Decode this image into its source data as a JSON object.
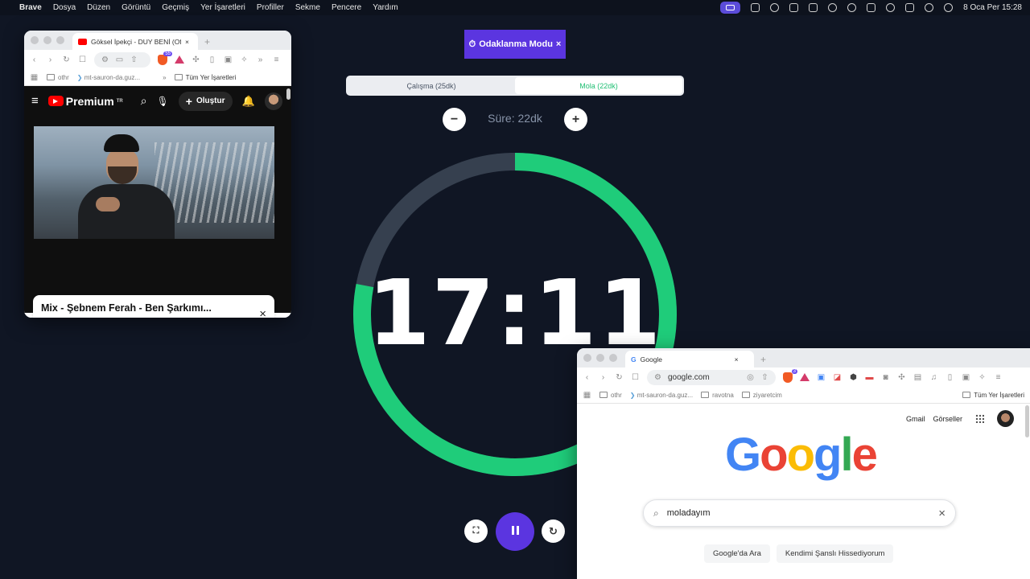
{
  "menubar": {
    "apple": "",
    "app": "Brave",
    "items": [
      "Dosya",
      "Düzen",
      "Görüntü",
      "Geçmiş",
      "Yer İşaretleri",
      "Profiller",
      "Sekme",
      "Pencere",
      "Yardım"
    ],
    "clock": "8 Oca Per  15:28"
  },
  "focus": {
    "badge": "Odaklanma Modu",
    "tabs": [
      "Çalışma (25dk)",
      "Mola (22dk)"
    ],
    "duration": "Süre: 22dk",
    "minus": "−",
    "plus": "+",
    "timer": "17:11",
    "progress": 0.78,
    "colors": {
      "accent": "#5b35e0",
      "ring": "#1fcc7a",
      "track": "#36404f"
    }
  },
  "yt_window": {
    "tab_title": "Göksel İpekçi - DUY BENİ (Offi",
    "tab_close": "×",
    "new_tab": "+",
    "brave_count": "55",
    "bookmarks": [
      "othr",
      "mt-sauron-da.guz...",
      "»",
      "Tüm Yer İşaretleri"
    ],
    "logo_text": "Premium",
    "logo_region": "TR",
    "create_label": "Oluştur",
    "mix_title": "Mix - Şebnem Ferah - Ben Şarkımı...",
    "mix_close": "×"
  },
  "g_window": {
    "tab_title": "Google",
    "tab_close": "×",
    "new_tab": "+",
    "url": "google.com",
    "brave_count": "3",
    "bookmarks": [
      "othr",
      "mt-sauron-da.guz...",
      "ravotna",
      "ziyaretcim",
      "Tüm Yer İşaretleri"
    ],
    "links": [
      "Gmail",
      "Görseller"
    ],
    "logo": [
      "G",
      "o",
      "o",
      "g",
      "l",
      "e"
    ],
    "logo_colors": [
      "#4285F4",
      "#EA4335",
      "#FBBC05",
      "#4285F4",
      "#34A853",
      "#EA4335"
    ],
    "search_value": "moladayım",
    "search_clear": "×",
    "buttons": [
      "Google'da Ara",
      "Kendimi Şanslı Hissediyorum"
    ]
  }
}
